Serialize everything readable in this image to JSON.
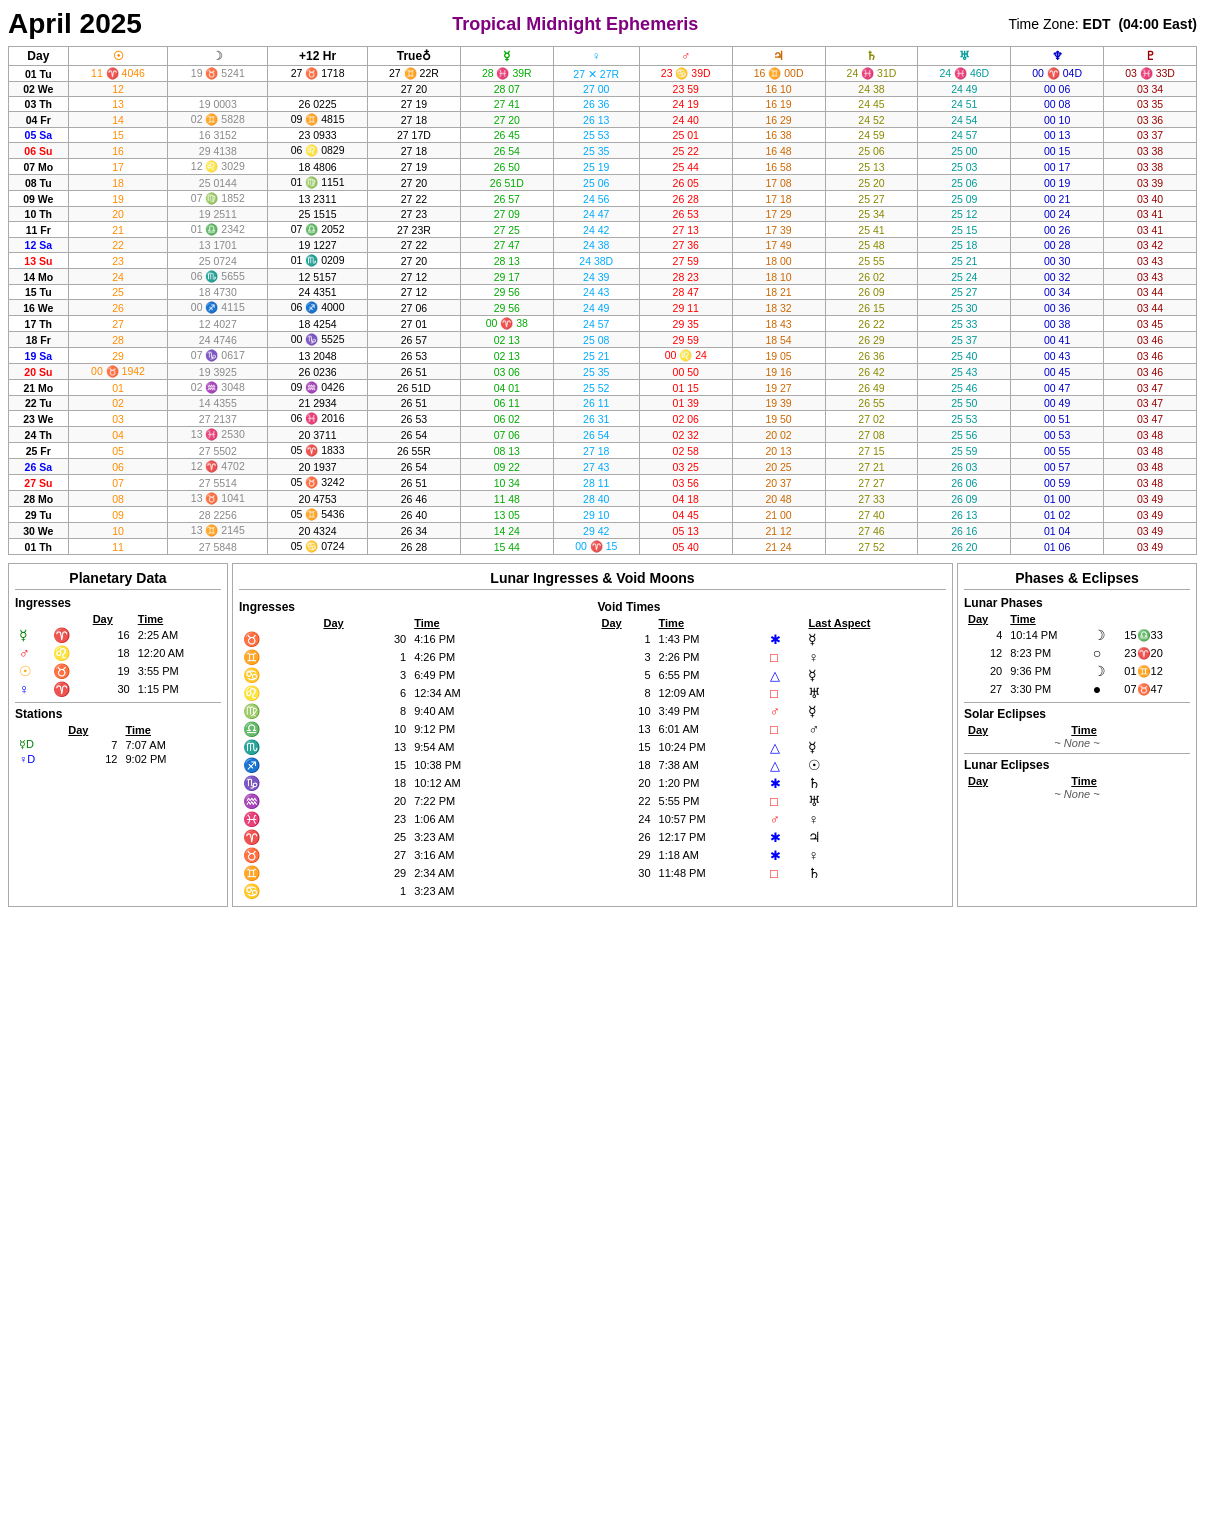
{
  "header": {
    "title": "April 2025",
    "center": "Tropical Midnight Ephemeris",
    "timezone": "Time Zone: EDT  (04:00 East)"
  },
  "columns": {
    "day": "Day",
    "sun": "☉",
    "moon": "☽",
    "plus12": "+12 Hr",
    "trueNode": "True♀",
    "mercury": "☿",
    "venus": "♀",
    "mars": "♂",
    "jupiter": "♃",
    "saturn": "♄",
    "uranus": "♅",
    "neptune": "♆",
    "pluto": "♇"
  },
  "rows": [
    {
      "n": "01",
      "wd": "Tu",
      "sun": "11 ♈ 4046",
      "moon": "19 ♉ 5241",
      "plus12": "27 ♉ 1718",
      "trueNode": "27 ♊ 22R",
      "mercury": "28 ♓ 39R",
      "venus": "27 ✕ 27R",
      "mars": "23 ♋ 39D",
      "jupiter": "16 ♊ 00D",
      "saturn": "24 ♓ 31D",
      "uranus": "24 ♓ 46D",
      "neptune": "00 ♈ 04D",
      "pluto": "03 ♓ 33D"
    },
    {
      "n": "02",
      "wd": "We",
      "sun": "12",
      "moon": "",
      "plus12": "",
      "trueNode": "27 20",
      "mercury": "28 07",
      "venus": "27 00",
      "mars": "23 59",
      "jupiter": "16 10",
      "saturn": "24 38",
      "uranus": "24 49",
      "neptune": "00 06",
      "pluto": "03 34"
    },
    {
      "n": "03",
      "wd": "Th",
      "sun": "13",
      "moon": "19 0003",
      "plus12": "26 0225",
      "trueNode": "27 19",
      "mercury": "27 41",
      "venus": "26 36",
      "mars": "24 19",
      "jupiter": "16 19",
      "saturn": "24 45",
      "uranus": "24 51",
      "neptune": "00 08",
      "pluto": "03 35"
    },
    {
      "n": "04",
      "wd": "Fr",
      "sun": "14",
      "moon": "02 ♊ 5828",
      "plus12": "09 ♊ 4815",
      "trueNode": "27 18",
      "mercury": "27 20",
      "venus": "26 13",
      "mars": "24 40",
      "jupiter": "16 29",
      "saturn": "24 52",
      "uranus": "24 54",
      "neptune": "00 10",
      "pluto": "03 36"
    },
    {
      "n": "05",
      "wd": "Sa",
      "sun": "15",
      "moon": "16 3152",
      "plus12": "23 0933",
      "trueNode": "27 17D",
      "mercury": "26 45",
      "venus": "25 53",
      "mars": "25 01",
      "jupiter": "16 38",
      "saturn": "24 59",
      "uranus": "24 57",
      "neptune": "00 13",
      "pluto": "03 37"
    },
    {
      "n": "06",
      "wd": "Su",
      "sun": "16",
      "moon": "29 4138",
      "plus12": "06 ♌ 0829",
      "trueNode": "27 18",
      "mercury": "26 54",
      "venus": "25 35",
      "mars": "25 22",
      "jupiter": "16 48",
      "saturn": "25 06",
      "uranus": "25 00",
      "neptune": "00 15",
      "pluto": "03 38"
    },
    {
      "n": "07",
      "wd": "Mo",
      "sun": "17",
      "moon": "12 ♌ 3029",
      "plus12": "18 4806",
      "trueNode": "27 19",
      "mercury": "26 50",
      "venus": "25 19",
      "mars": "25 44",
      "jupiter": "16 58",
      "saturn": "25 13",
      "uranus": "25 03",
      "neptune": "00 17",
      "pluto": "03 38"
    },
    {
      "n": "08",
      "wd": "Tu",
      "sun": "18",
      "moon": "25 0144",
      "plus12": "01 ♍ 1151",
      "trueNode": "27 20",
      "mercury": "26 51D",
      "venus": "25 06",
      "mars": "26 05",
      "jupiter": "17 08",
      "saturn": "25 20",
      "uranus": "25 06",
      "neptune": "00 19",
      "pluto": "03 39"
    },
    {
      "n": "09",
      "wd": "We",
      "sun": "19",
      "moon": "07 ♍ 1852",
      "plus12": "13 2311",
      "trueNode": "27 22",
      "mercury": "26 57",
      "venus": "24 56",
      "mars": "26 28",
      "jupiter": "17 18",
      "saturn": "25 27",
      "uranus": "25 09",
      "neptune": "00 21",
      "pluto": "03 40"
    },
    {
      "n": "10",
      "wd": "Th",
      "sun": "20",
      "moon": "19 2511",
      "plus12": "25 1515",
      "trueNode": "27 23",
      "mercury": "27 09",
      "venus": "24 47",
      "mars": "26 53",
      "jupiter": "17 29",
      "saturn": "25 34",
      "uranus": "25 12",
      "neptune": "00 24",
      "pluto": "03 41"
    },
    {
      "n": "11",
      "wd": "Fr",
      "sun": "21",
      "moon": "01 ♎ 2342",
      "plus12": "07 ♎ 2052",
      "trueNode": "27 23R",
      "mercury": "27 25",
      "venus": "24 42",
      "mars": "27 13",
      "jupiter": "17 39",
      "saturn": "25 41",
      "uranus": "25 15",
      "neptune": "00 26",
      "pluto": "03 41"
    },
    {
      "n": "12",
      "wd": "Sa",
      "sun": "22",
      "moon": "13 1701",
      "plus12": "19 1227",
      "trueNode": "27 22",
      "mercury": "27 47",
      "venus": "24 38",
      "mars": "27 36",
      "jupiter": "17 49",
      "saturn": "25 48",
      "uranus": "25 18",
      "neptune": "00 28",
      "pluto": "03 42"
    },
    {
      "n": "13",
      "wd": "Su",
      "sun": "23",
      "moon": "25 0724",
      "plus12": "01 ♏ 0209",
      "trueNode": "27 20",
      "mercury": "28 13",
      "venus": "24 38D",
      "mars": "27 59",
      "jupiter": "18 00",
      "saturn": "25 55",
      "uranus": "25 21",
      "neptune": "00 30",
      "pluto": "03 43"
    },
    {
      "n": "14",
      "wd": "Mo",
      "sun": "24",
      "moon": "06 ♏ 5655",
      "plus12": "12 5157",
      "trueNode": "27 12",
      "mercury": "29 17",
      "venus": "24 39",
      "mars": "28 23",
      "jupiter": "18 10",
      "saturn": "26 02",
      "uranus": "25 24",
      "neptune": "00 32",
      "pluto": "03 43"
    },
    {
      "n": "15",
      "wd": "Tu",
      "sun": "25",
      "moon": "18 4730",
      "plus12": "24 4351",
      "trueNode": "27 12",
      "mercury": "29 56",
      "venus": "24 43",
      "mars": "28 47",
      "jupiter": "18 21",
      "saturn": "26 09",
      "uranus": "25 27",
      "neptune": "00 34",
      "pluto": "03 44"
    },
    {
      "n": "16",
      "wd": "We",
      "sun": "26",
      "moon": "00 ♐ 4115",
      "plus12": "06 ♐ 4000",
      "trueNode": "27 06",
      "mercury": "29 56",
      "venus": "24 49",
      "mars": "29 11",
      "jupiter": "18 32",
      "saturn": "26 15",
      "uranus": "25 30",
      "neptune": "00 36",
      "pluto": "03 44"
    },
    {
      "n": "17",
      "wd": "Th",
      "sun": "27",
      "moon": "12 4027",
      "plus12": "18 4254",
      "trueNode": "27 01",
      "mercury": "00 ♈ 38",
      "venus": "24 57",
      "mars": "29 35",
      "jupiter": "18 43",
      "saturn": "26 22",
      "uranus": "25 33",
      "neptune": "00 38",
      "pluto": "03 45"
    },
    {
      "n": "18",
      "wd": "Fr",
      "sun": "28",
      "moon": "24 4746",
      "plus12": "00 ♑ 5525",
      "trueNode": "26 57",
      "mercury": "02 13",
      "venus": "25 08",
      "mars": "29 59",
      "jupiter": "18 54",
      "saturn": "26 29",
      "uranus": "25 37",
      "neptune": "00 41",
      "pluto": "03 46"
    },
    {
      "n": "19",
      "wd": "Sa",
      "sun": "29",
      "moon": "07 ♑ 0617",
      "plus12": "13 2048",
      "trueNode": "26 53",
      "mercury": "02 13",
      "venus": "25 21",
      "mars": "00 ♌ 24",
      "jupiter": "19 05",
      "saturn": "26 36",
      "uranus": "25 40",
      "neptune": "00 43",
      "pluto": "03 46"
    },
    {
      "n": "20",
      "wd": "Su",
      "sun": "00 ♉ 1942",
      "moon": "19 3925",
      "plus12": "26 0236",
      "trueNode": "26 51",
      "mercury": "03 06",
      "venus": "25 35",
      "mars": "00 50",
      "jupiter": "19 16",
      "saturn": "26 42",
      "uranus": "25 43",
      "neptune": "00 45",
      "pluto": "03 46"
    },
    {
      "n": "21",
      "wd": "Mo",
      "sun": "01",
      "moon": "02 ♒ 3048",
      "plus12": "09 ♒ 0426",
      "trueNode": "26 51D",
      "mercury": "04 01",
      "venus": "25 52",
      "mars": "01 15",
      "jupiter": "19 27",
      "saturn": "26 49",
      "uranus": "25 46",
      "neptune": "00 47",
      "pluto": "03 47"
    },
    {
      "n": "22",
      "wd": "Tu",
      "sun": "02",
      "moon": "14 4355",
      "plus12": "21 2934",
      "trueNode": "26 51",
      "mercury": "06 11",
      "venus": "26 11",
      "mars": "01 39",
      "jupiter": "19 39",
      "saturn": "26 55",
      "uranus": "25 50",
      "neptune": "00 49",
      "pluto": "03 47"
    },
    {
      "n": "23",
      "wd": "We",
      "sun": "03",
      "moon": "27 2137",
      "plus12": "06 ♓ 2016",
      "trueNode": "26 53",
      "mercury": "06 02",
      "venus": "26 31",
      "mars": "02 06",
      "jupiter": "19 50",
      "saturn": "27 02",
      "uranus": "25 53",
      "neptune": "00 51",
      "pluto": "03 47"
    },
    {
      "n": "24",
      "wd": "Th",
      "sun": "04",
      "moon": "13 ♓ 2530",
      "plus12": "20 3711",
      "trueNode": "26 54",
      "mercury": "07 06",
      "venus": "26 54",
      "mars": "02 32",
      "jupiter": "20 02",
      "saturn": "27 08",
      "uranus": "25 56",
      "neptune": "00 53",
      "pluto": "03 48"
    },
    {
      "n": "25",
      "wd": "Fr",
      "sun": "05",
      "moon": "27 5502",
      "plus12": "05 ♈ 1833",
      "trueNode": "26 55R",
      "mercury": "08 13",
      "venus": "27 18",
      "mars": "02 58",
      "jupiter": "20 13",
      "saturn": "27 15",
      "uranus": "25 59",
      "neptune": "00 55",
      "pluto": "03 48"
    },
    {
      "n": "26",
      "wd": "Sa",
      "sun": "06",
      "moon": "12 ♈ 4702",
      "plus12": "20 1937",
      "trueNode": "26 54",
      "mercury": "09 22",
      "venus": "27 43",
      "mars": "03 25",
      "jupiter": "20 25",
      "saturn": "27 21",
      "uranus": "26 03",
      "neptune": "00 57",
      "pluto": "03 48"
    },
    {
      "n": "27",
      "wd": "Su",
      "sun": "07",
      "moon": "27 5514",
      "plus12": "05 ♉ 3242",
      "trueNode": "26 51",
      "mercury": "10 34",
      "venus": "28 11",
      "mars": "03 56",
      "jupiter": "20 37",
      "saturn": "27 27",
      "uranus": "26 06",
      "neptune": "00 59",
      "pluto": "03 48"
    },
    {
      "n": "28",
      "wd": "Mo",
      "sun": "08",
      "moon": "13 ♉ 1041",
      "plus12": "20 4753",
      "trueNode": "26 46",
      "mercury": "11 48",
      "venus": "28 40",
      "mars": "04 18",
      "jupiter": "20 48",
      "saturn": "27 33",
      "uranus": "26 09",
      "neptune": "01 00",
      "pluto": "03 49"
    },
    {
      "n": "29",
      "wd": "Tu",
      "sun": "09",
      "moon": "28 2256",
      "plus12": "05 ♊ 5436",
      "trueNode": "26 40",
      "mercury": "13 05",
      "venus": "29 10",
      "mars": "04 45",
      "jupiter": "21 00",
      "saturn": "27 40",
      "uranus": "26 13",
      "neptune": "01 02",
      "pluto": "03 49"
    },
    {
      "n": "30",
      "wd": "We",
      "sun": "10",
      "moon": "13 ♊ 2145",
      "plus12": "20 4324",
      "trueNode": "26 34",
      "mercury": "14 24",
      "venus": "29 42",
      "mars": "05 13",
      "jupiter": "21 12",
      "saturn": "27 46",
      "uranus": "26 16",
      "neptune": "01 04",
      "pluto": "03 49"
    },
    {
      "n": "01",
      "wd": "Th",
      "sun": "11",
      "moon": "27 5848",
      "plus12": "05 ♋ 0724",
      "trueNode": "26 28",
      "mercury": "15 44",
      "venus": "00 ♈ 15",
      "mars": "05 40",
      "jupiter": "21 24",
      "saturn": "27 52",
      "uranus": "26 20",
      "neptune": "01 06",
      "pluto": "03 49"
    }
  ],
  "planetary": {
    "title": "Planetary Data",
    "ingresses_title": "Ingresses",
    "ingresses_hdr": [
      "",
      "",
      "Day",
      "Time"
    ],
    "ingresses": [
      {
        "planet": "☿",
        "sign": "♈",
        "day": "16",
        "time": "2:25 AM",
        "pcolor": "green",
        "scolor": "red"
      },
      {
        "planet": "♂",
        "sign": "♌",
        "day": "18",
        "time": "12:20 AM",
        "pcolor": "red",
        "scolor": "orange"
      },
      {
        "planet": "☉",
        "sign": "♉",
        "day": "19",
        "time": "3:55 PM",
        "pcolor": "orange",
        "scolor": "orange"
      },
      {
        "planet": "♀",
        "sign": "♈",
        "day": "30",
        "time": "1:15 PM",
        "pcolor": "blue",
        "scolor": "red"
      }
    ],
    "stations_title": "Stations",
    "stations_hdr": [
      "",
      "",
      "Day",
      "Time"
    ],
    "stations": [
      {
        "planet": "☿D",
        "day": "7",
        "time": "7:07 AM",
        "pcolor": "green"
      },
      {
        "planet": "♀D",
        "day": "12",
        "time": "9:02 PM",
        "pcolor": "blue"
      }
    ]
  },
  "lunar": {
    "title": "Lunar Ingresses & Void Moons",
    "ingresses_title": "Ingresses",
    "ingresses_hdr": [
      "",
      "Day",
      "Time"
    ],
    "ingresses": [
      {
        "sign": "♉",
        "day": "30",
        "time": "4:16 PM"
      },
      {
        "sign": "♊",
        "day": "1",
        "time": "4:26 PM"
      },
      {
        "sign": "♋",
        "day": "3",
        "time": "6:49 PM"
      },
      {
        "sign": "♌",
        "day": "6",
        "time": "12:34 AM"
      },
      {
        "sign": "♍",
        "day": "8",
        "time": "9:40 AM"
      },
      {
        "sign": "♎",
        "day": "10",
        "time": "9:12 PM"
      },
      {
        "sign": "♏",
        "day": "13",
        "time": "9:54 AM"
      },
      {
        "sign": "♐",
        "day": "15",
        "time": "10:38 PM"
      },
      {
        "sign": "♑",
        "day": "18",
        "time": "10:12 AM"
      },
      {
        "sign": "♒",
        "day": "20",
        "time": "7:22 PM"
      },
      {
        "sign": "♓",
        "day": "23",
        "time": "1:06 AM"
      },
      {
        "sign": "♈",
        "day": "25",
        "time": "3:23 AM"
      },
      {
        "sign": "♉",
        "day": "27",
        "time": "3:16 AM"
      },
      {
        "sign": "♊",
        "day": "29",
        "time": "2:34 AM"
      },
      {
        "sign": "♋",
        "day": "1",
        "time": "3:23 AM"
      }
    ],
    "void_title": "Void Times",
    "void_hdr": [
      "Day",
      "Time",
      "",
      "Last Aspect"
    ],
    "voids": [
      {
        "day": "1",
        "time": "1:43 PM",
        "symbol": "✱",
        "aspect_planet": "☿",
        "sym_color": "blue"
      },
      {
        "day": "3",
        "time": "2:26 PM",
        "symbol": "□",
        "aspect_planet": "♀",
        "sym_color": "red"
      },
      {
        "day": "5",
        "time": "6:55 PM",
        "symbol": "△",
        "aspect_planet": "☿",
        "sym_color": "blue"
      },
      {
        "day": "8",
        "time": "12:09 AM",
        "symbol": "□",
        "aspect_planet": "♅",
        "sym_color": "red"
      },
      {
        "day": "10",
        "time": "3:49 PM",
        "symbol": "♂",
        "aspect_planet": "☿",
        "sym_color": "red"
      },
      {
        "day": "13",
        "time": "6:01 AM",
        "symbol": "□",
        "aspect_planet": "♂",
        "sym_color": "red"
      },
      {
        "day": "15",
        "time": "10:24 PM",
        "symbol": "△",
        "aspect_planet": "☿",
        "sym_color": "blue"
      },
      {
        "day": "18",
        "time": "7:38 AM",
        "symbol": "△",
        "aspect_planet": "☉",
        "sym_color": "blue"
      },
      {
        "day": "20",
        "time": "1:20 PM",
        "symbol": "✱",
        "aspect_planet": "♄",
        "sym_color": "blue"
      },
      {
        "day": "22",
        "time": "5:55 PM",
        "symbol": "□",
        "aspect_planet": "♅",
        "sym_color": "red"
      },
      {
        "day": "24",
        "time": "10:57 PM",
        "symbol": "♂",
        "aspect_planet": "♀",
        "sym_color": "red"
      },
      {
        "day": "26",
        "time": "12:17 PM",
        "symbol": "✱",
        "aspect_planet": "♃",
        "sym_color": "blue"
      },
      {
        "day": "29",
        "time": "1:18 AM",
        "symbol": "✱",
        "aspect_planet": "♀",
        "sym_color": "blue"
      },
      {
        "day": "30",
        "time": "11:48 PM",
        "symbol": "□",
        "aspect_planet": "♄",
        "sym_color": "red"
      }
    ]
  },
  "phases": {
    "title": "Phases & Eclipses",
    "lunar_phases_title": "Lunar Phases",
    "lunar_phases_hdr": [
      "Day",
      "Time"
    ],
    "lunar_phases": [
      {
        "day": "4",
        "time": "10:14 PM",
        "symbol": "☽",
        "desc": "15♎33"
      },
      {
        "day": "12",
        "time": "8:23 PM",
        "symbol": "○",
        "desc": "23♈20"
      },
      {
        "day": "20",
        "time": "9:36 PM",
        "symbol": "☽",
        "desc": "01♊12"
      },
      {
        "day": "27",
        "time": "3:30 PM",
        "symbol": "●",
        "desc": "07♉47"
      }
    ],
    "solar_eclipses_title": "Solar Eclipses",
    "solar_eclipses_hdr": [
      "Day",
      "Time"
    ],
    "solar_eclipses_none": "~ None ~",
    "lunar_eclipses_title": "Lunar Eclipses",
    "lunar_eclipses_hdr": [
      "Day",
      "Time"
    ],
    "lunar_eclipses_none": "~ None ~"
  }
}
